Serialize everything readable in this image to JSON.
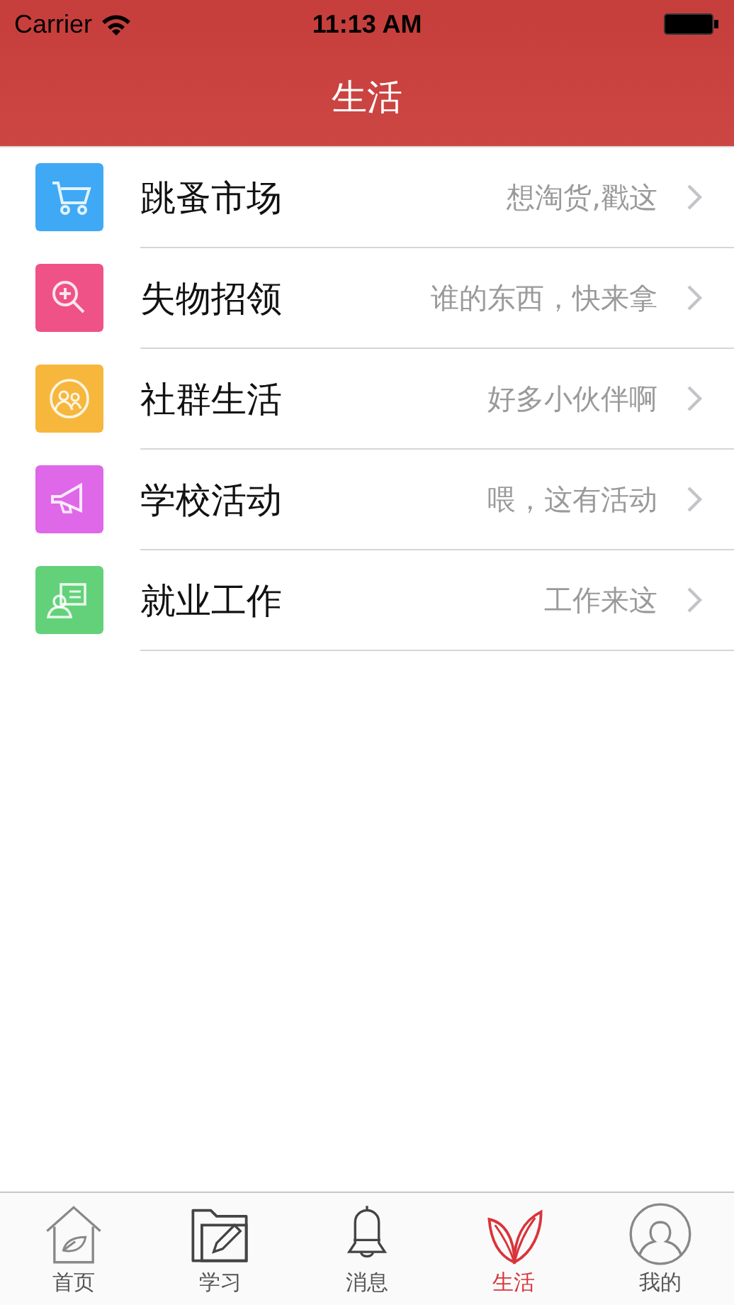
{
  "status_bar": {
    "carrier": "Carrier",
    "time": "11:13 AM"
  },
  "nav": {
    "title": "生活"
  },
  "items": [
    {
      "kind": "cart",
      "color": "#3fa9f5",
      "title": "跳蚤市场",
      "subtitle": "想淘货,戳这"
    },
    {
      "kind": "search",
      "color": "#ef5287",
      "title": "失物招领",
      "subtitle": "谁的东西，快来拿"
    },
    {
      "kind": "group",
      "color": "#f6b73c",
      "title": "社群生活",
      "subtitle": "好多小伙伴啊"
    },
    {
      "kind": "megaphone",
      "color": "#de68e8",
      "title": "学校活动",
      "subtitle": "喂，这有活动"
    },
    {
      "kind": "card",
      "color": "#63d17a",
      "title": "就业工作",
      "subtitle": "工作来这"
    }
  ],
  "tabs": [
    {
      "kind": "home",
      "label": "首页",
      "selected": false
    },
    {
      "kind": "folder",
      "label": "学习",
      "selected": false
    },
    {
      "kind": "bell",
      "label": "消息",
      "selected": false
    },
    {
      "kind": "leaves",
      "label": "生活",
      "selected": true
    },
    {
      "kind": "person",
      "label": "我的",
      "selected": false
    }
  ]
}
